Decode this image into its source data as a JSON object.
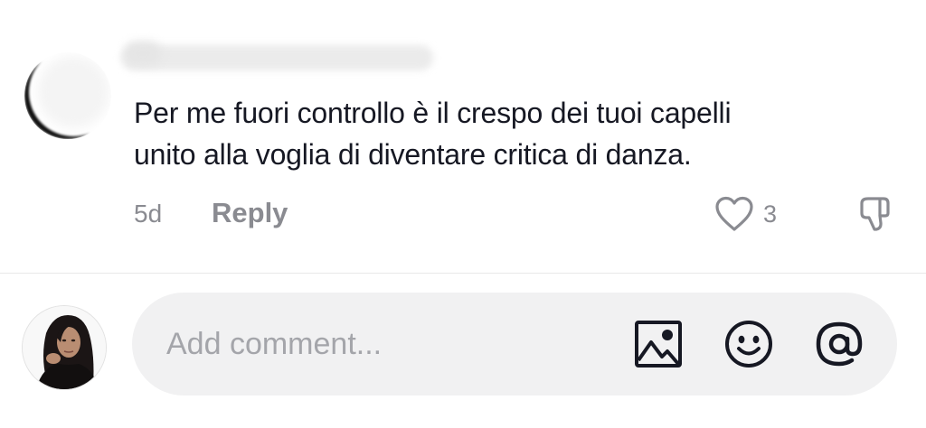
{
  "comment": {
    "text_lines": [
      "Per me fuori controllo è il crespo dei tuoi capelli",
      "unito alla voglia di diventare critica di danza."
    ],
    "time": "5d",
    "reply_label": "Reply",
    "like_count": "3",
    "icons": {
      "like": "heart-outline-icon",
      "dislike": "thumbs-down-icon"
    }
  },
  "composer": {
    "placeholder": "Add comment...",
    "icons": [
      "image-icon",
      "emoji-icon",
      "mention-icon"
    ]
  },
  "colors": {
    "text_primary": "#161823",
    "text_secondary": "#8a8b91",
    "input_background": "#f1f1f2"
  }
}
